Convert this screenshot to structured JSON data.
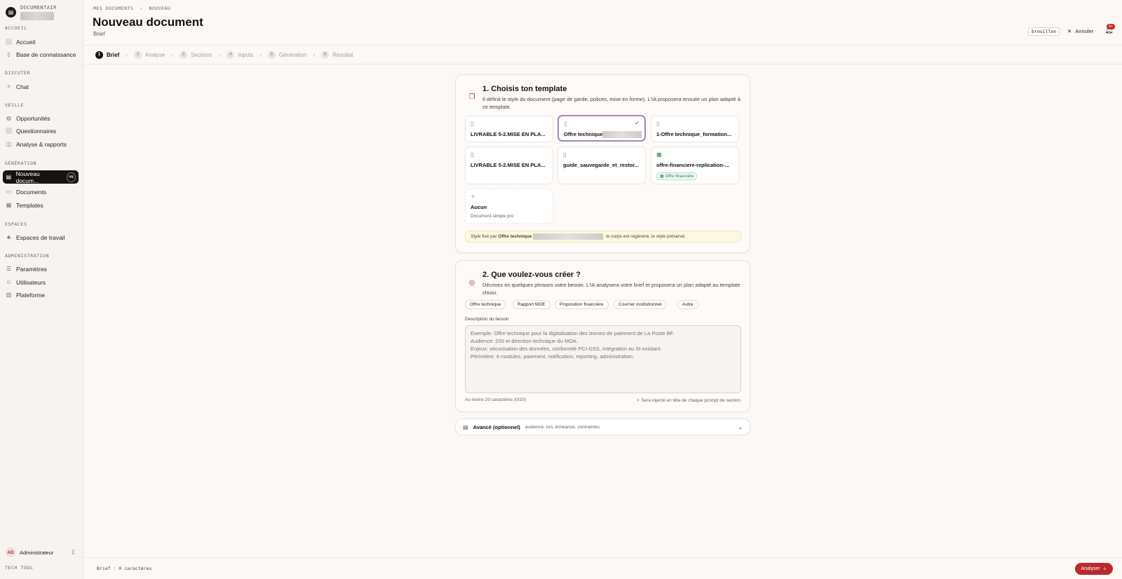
{
  "sidebar": {
    "brand": "DOCUMENTAIR",
    "sections": [
      {
        "label": "ACCUEIL",
        "items": [
          {
            "label": "Accueil",
            "icon": "home-icon"
          },
          {
            "label": "Base de connaissance",
            "icon": "book-icon"
          }
        ]
      },
      {
        "label": "DISCUTER",
        "items": [
          {
            "label": "Chat",
            "icon": "sparkle-icon"
          }
        ]
      },
      {
        "label": "VEILLE",
        "items": [
          {
            "label": "Opportunités",
            "icon": "globe-icon"
          },
          {
            "label": "Questionnaires",
            "icon": "clipboard-icon"
          },
          {
            "label": "Analyse & rapports",
            "icon": "chart-icon"
          }
        ]
      },
      {
        "label": "GÉNÉRATION",
        "items": [
          {
            "label": "Nouveau docum...",
            "icon": "file-plus-icon",
            "shortcut": "⌘N"
          },
          {
            "label": "Documents",
            "icon": "files-icon"
          },
          {
            "label": "Templates",
            "icon": "layout-icon"
          }
        ]
      },
      {
        "label": "ESPACES",
        "items": [
          {
            "label": "Espaces de travail",
            "icon": "users-icon"
          }
        ]
      },
      {
        "label": "ADMINISTRATION",
        "items": [
          {
            "label": "Paramètres",
            "icon": "sliders-icon"
          },
          {
            "label": "Utilisateurs",
            "icon": "user-icon"
          },
          {
            "label": "Plateforme",
            "icon": "server-icon"
          }
        ]
      }
    ],
    "user": {
      "initials": "AD",
      "name": "Administrateur"
    },
    "footer": "TECH TOOL"
  },
  "header": {
    "breadcrumb": "MES DOCUMENTS  ›  NOUVEAU",
    "title": "Nouveau document",
    "subtitle": "Brief",
    "status": "brouillon",
    "cancel": "Annuler",
    "notifications": "9+"
  },
  "steps": [
    {
      "num": "1",
      "label": "Brief"
    },
    {
      "num": "2",
      "label": "Analyse"
    },
    {
      "num": "3",
      "label": "Sections"
    },
    {
      "num": "4",
      "label": "Inputs"
    },
    {
      "num": "5",
      "label": "Génération"
    },
    {
      "num": "6",
      "label": "Résultat"
    }
  ],
  "template_section": {
    "title": "1. Choisis ton template",
    "desc": "Il définit le style du document (page de garde, polices, mise en forme). L'IA proposera ensuite un plan adapté à ce template.",
    "templates": [
      {
        "name": "LIVRABLE 5-2.MISE EN PLA..."
      },
      {
        "name": "Offre technique"
      },
      {
        "name": "1-Offre technique_formation..."
      },
      {
        "name": "LIVRABLE 5-2.MISE EN PLA..."
      },
      {
        "name": "guide_sauvegarde_et_restor..."
      },
      {
        "name": "offre-financiere-replication-...",
        "tag": "Offre financière"
      },
      {
        "name": "Aucun",
        "sub": "Document simple pro"
      }
    ],
    "notice_prefix": "Style fixé par",
    "notice_bold": "Offre technique",
    "notice_suffix": "le corps est régénéré, le style préservé."
  },
  "brief_section": {
    "title": "2. Que voulez-vous créer ?",
    "desc": "Décrivez en quelques phrases votre besoin. L'IA analysera votre brief et proposera un plan adapté au template choisi.",
    "chips": [
      "Offre technique",
      "Rapport MOE",
      "Proposition financière",
      "Courrier institutionnel",
      "Autre"
    ],
    "field_label": "Description du besoin",
    "placeholder": "Exemple: Offre technique pour la digitalisation des bornes de paiement de La Poste BF.\nAudience: DSI et direction technique du MOA.\nEnjeux: sécurisation des données, conformité PCI-DSS, intégration au SI existant.\nPérimètre: 4 modules, paiement, notification, reporting, administration.",
    "hint_left": "Au moins 20 caractères (0/20)",
    "hint_right": "Sera injecté en tête de chaque prompt de section"
  },
  "advanced": {
    "title": "Avancé (optionnel)",
    "sub": "audience, ton, échéance, contraintes"
  },
  "footer": {
    "count": "Brief : 0 caractères",
    "analyse": "Analyser"
  }
}
